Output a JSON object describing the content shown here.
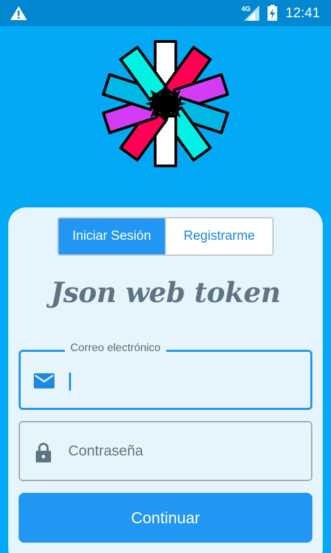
{
  "status_bar": {
    "network_label": "4G",
    "time": "12:41"
  },
  "auth_tabs": {
    "login": "Iniciar Sesión",
    "register": "Registrarme"
  },
  "app_title": "Json web token",
  "email_field": {
    "label": "Correo electrónico",
    "value": ""
  },
  "password_field": {
    "placeholder": "Contraseña"
  },
  "submit_label": "Continuar",
  "icons": [
    "warning-icon",
    "signal-icon",
    "battery-charging-icon",
    "jwt-logo",
    "email-icon",
    "lock-icon"
  ],
  "colors": {
    "background": "#03a9f4",
    "status_bar": "#0288d1",
    "card": "#e6f5fd",
    "primary": "#2196f3",
    "title": "#5f7480"
  }
}
